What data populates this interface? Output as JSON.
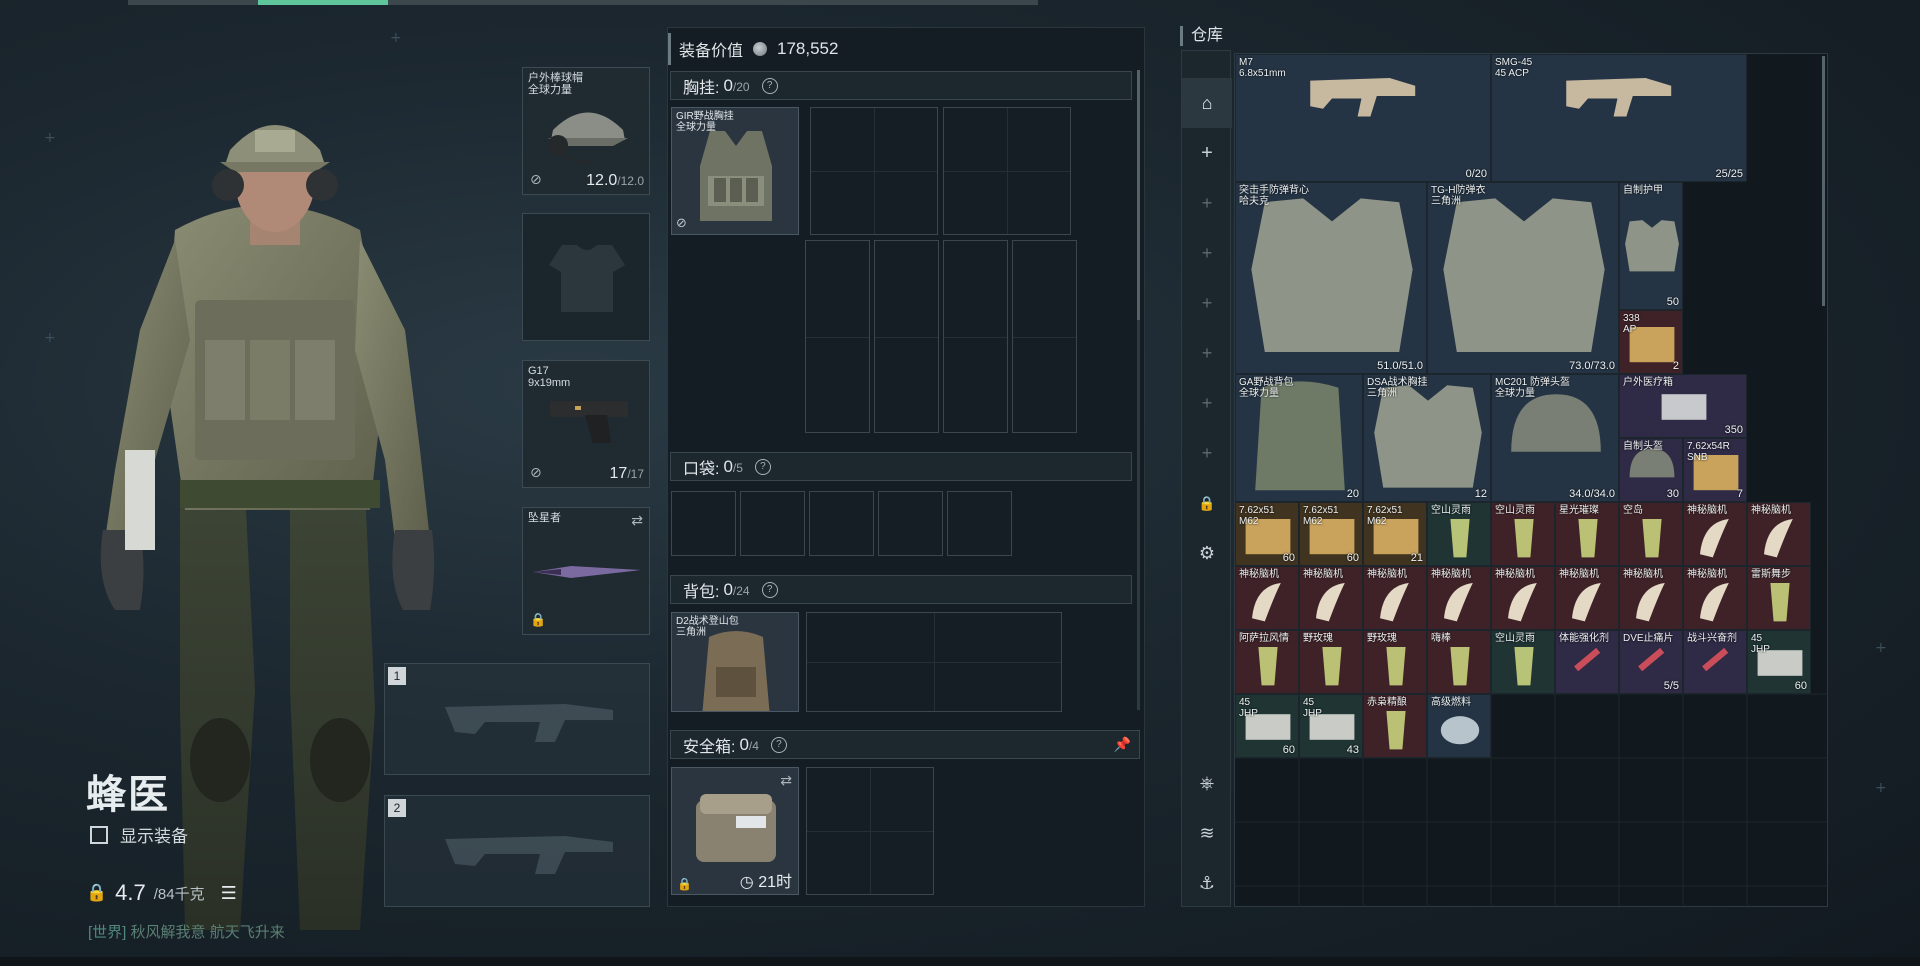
{
  "character": {
    "name": "蜂医",
    "show_equipment_label": "显示装备",
    "weight_value": "4.7",
    "weight_max": "/84千克",
    "chat_channel": "[世界]",
    "chat_user": "秋风解我意",
    "chat_message": "航天飞升来"
  },
  "equipment_slots": {
    "helmet": {
      "label": "户外棒球帽\n全球力量",
      "durability": "12.0",
      "durability_max": "/12.0"
    },
    "armor": {
      "label": ""
    },
    "pistol": {
      "label": "G17\n9x19mm",
      "ammo": "17",
      "ammo_max": "/17"
    },
    "melee": {
      "label": "坠星者"
    },
    "weapon_slot_1": "1",
    "weapon_slot_2": "2"
  },
  "gear_panel": {
    "title": "装备价值",
    "value": "178,552",
    "chest_rig": {
      "label": "胸挂:",
      "count": "0",
      "capacity": "/20",
      "item": "GIR野战胸挂\n全球力量"
    },
    "pockets": {
      "label": "口袋:",
      "count": "0",
      "capacity": "/5"
    },
    "backpack": {
      "label": "背包:",
      "count": "0",
      "capacity": "/24",
      "item": "D2战术登山包\n三角洲"
    },
    "safebox": {
      "label": "安全箱:",
      "count": "0",
      "capacity": "/4",
      "timer": "21时"
    }
  },
  "stash": {
    "title": "仓库",
    "items": [
      {
        "label": "M7\n6.8x51mm",
        "qty": "0/20",
        "color": "blue"
      },
      {
        "label": "SMG-45\n45 ACP",
        "qty": "25/25",
        "color": "blue"
      },
      {
        "label": "突击手防弹背心\n哈夫克",
        "qty": "51.0/51.0",
        "color": "blue"
      },
      {
        "label": "TG-H防弹衣\n三角洲",
        "qty": "73.0/73.0",
        "color": "blue"
      },
      {
        "label": "自制护甲",
        "qty": "50",
        "color": "blue"
      },
      {
        "label": "338\nAP",
        "qty": "2",
        "color": "red"
      },
      {
        "label": "GA野战背包\n全球力量",
        "qty": "20",
        "color": "blue"
      },
      {
        "label": "DSA战术胸挂\n三角洲",
        "qty": "12",
        "color": "blue"
      },
      {
        "label": "MC201 防弹头盔\n全球力量",
        "qty": "34.0/34.0",
        "color": "blue"
      },
      {
        "label": "户外医疗箱",
        "qty": "350",
        "color": "purple"
      },
      {
        "label": "自制头盔",
        "qty": "30",
        "color": "purple"
      },
      {
        "label": "7.62x54R\nSNB",
        "qty": "7",
        "color": "purple"
      },
      {
        "label": "7.62x51\nM62",
        "qty": "60",
        "color": "gold"
      },
      {
        "label": "7.62x51\nM62",
        "qty": "60",
        "color": "gold"
      },
      {
        "label": "7.62x51\nM62",
        "qty": "21",
        "color": "gold"
      },
      {
        "label": "空山灵雨",
        "qty": "",
        "color": "green"
      },
      {
        "label": "空山灵雨",
        "qty": "",
        "color": "red"
      },
      {
        "label": "星光璀璨",
        "qty": "",
        "color": "red"
      },
      {
        "label": "空岛",
        "qty": "",
        "color": "red"
      },
      {
        "label": "神秘脑机",
        "qty": "",
        "color": "red"
      },
      {
        "label": "神秘脑机",
        "qty": "",
        "color": "red"
      },
      {
        "label": "神秘脑机",
        "qty": "",
        "color": "red"
      },
      {
        "label": "神秘脑机",
        "qty": "",
        "color": "red"
      },
      {
        "label": "神秘脑机",
        "qty": "",
        "color": "red"
      },
      {
        "label": "神秘脑机",
        "qty": "",
        "color": "red"
      },
      {
        "label": "神秘脑机",
        "qty": "",
        "color": "red"
      },
      {
        "label": "神秘脑机",
        "qty": "",
        "color": "red"
      },
      {
        "label": "神秘脑机",
        "qty": "",
        "color": "red"
      },
      {
        "label": "神秘脑机",
        "qty": "",
        "color": "red"
      },
      {
        "label": "雷斯舞步",
        "qty": "",
        "color": "red"
      },
      {
        "label": "阿萨拉风情",
        "qty": "",
        "color": "red"
      },
      {
        "label": "野玫瑰",
        "qty": "",
        "color": "red"
      },
      {
        "label": "野玫瑰",
        "qty": "",
        "color": "red"
      },
      {
        "label": "嗨棒",
        "qty": "",
        "color": "red"
      },
      {
        "label": "空山灵雨",
        "qty": "",
        "color": "green"
      },
      {
        "label": "体能强化剂",
        "qty": "",
        "color": "purple"
      },
      {
        "label": "DVE止痛片",
        "qty": "5/5",
        "color": "purple"
      },
      {
        "label": "战斗兴奋剂",
        "qty": "",
        "color": "purple"
      },
      {
        "label": "45\nJHP",
        "qty": "60",
        "color": "green"
      },
      {
        "label": "45\nJHP",
        "qty": "60",
        "color": "green"
      },
      {
        "label": "45\nJHP",
        "qty": "43",
        "color": "green"
      },
      {
        "label": "赤枭精酿",
        "qty": "",
        "color": "red"
      },
      {
        "label": "高级燃料",
        "qty": "",
        "color": "blue"
      }
    ]
  },
  "colors": {
    "accent_green": "#5fc59a",
    "panel_bg": "#141d23",
    "stash_blue": "#253444",
    "stash_purple": "#2f2a45",
    "stash_red": "#3f2227",
    "stash_green": "#1f3433",
    "stash_gold": "#40331f"
  },
  "icons": {
    "stash_sidebar": [
      "home-icon",
      "plus-icon",
      "plus-icon",
      "plus-icon",
      "plus-icon",
      "plus-icon",
      "plus-icon",
      "plus-icon",
      "lock-icon",
      "gear-icon",
      "character-icon",
      "layers-icon",
      "anchor-icon"
    ]
  }
}
